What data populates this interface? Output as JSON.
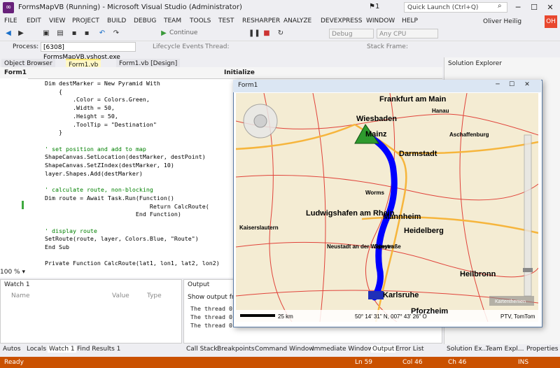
{
  "window": {
    "title": "FormsMapVB (Running) - Microsoft Visual Studio (Administrator)",
    "flag_count": "1",
    "quick_launch_placeholder": "Quick Launch (Ctrl+Q)",
    "user_name": "Oliver Heilig",
    "user_initials": "OH"
  },
  "menu": [
    "FILE",
    "EDIT",
    "VIEW",
    "PROJECT",
    "BUILD",
    "DEBUG",
    "TEAM",
    "TOOLS",
    "TEST",
    "RESHARPER",
    "ANALYZE",
    "DEVEXPRESS",
    "WINDOW",
    "HELP"
  ],
  "toolbar": {
    "continue_label": "Continue",
    "config": "Debug",
    "platform": "Any CPU"
  },
  "processbar": {
    "process_label": "Process:",
    "process_value": "[6308] FormsMapVB.vshost.exe",
    "lifecycle": "Lifecycle Events",
    "thread_label": "Thread:",
    "stack_label": "Stack Frame:"
  },
  "doc_tabs": {
    "object_browser": "Object Browser",
    "form1_vb": "Form1.vb",
    "form1_design": "Form1.vb [Design]",
    "nav_left": "Form1",
    "nav_right": "Initialize"
  },
  "code_lines": [
    {
      "t": "Dim destMarker = New Pyramid With"
    },
    {
      "t": "    {"
    },
    {
      "t": "        .Color = Colors.Green,"
    },
    {
      "t": "        .Width = 50,"
    },
    {
      "t": "        .Height = 50,"
    },
    {
      "t": "        .ToolTip = \"Destination\""
    },
    {
      "t": "    }"
    },
    {
      "t": ""
    },
    {
      "t": "' set position and add to map"
    },
    {
      "t": "ShapeCanvas.SetLocation(destMarker, destPoint)"
    },
    {
      "t": "ShapeCanvas.SetZIndex(destMarker, 10)"
    },
    {
      "t": "layer.Shapes.Add(destMarker)"
    },
    {
      "t": ""
    },
    {
      "t": "' calculate route, non-blocking"
    },
    {
      "t": "Dim route = Await Task.Run(Function()"
    },
    {
      "t": "                              Return CalcRoute("
    },
    {
      "t": "                          End Function)"
    },
    {
      "t": ""
    },
    {
      "t": "' display route"
    },
    {
      "t": "SetRoute(route, layer, Colors.Blue, \"Route\")"
    },
    {
      "t": "End Sub"
    },
    {
      "t": ""
    },
    {
      "t": "Private Function CalcRoute(lat1, lon1, lat2, lon2)"
    }
  ],
  "zoom_level": "100 %",
  "watch": {
    "title": "Watch 1",
    "col_name": "Name",
    "col_value": "Value",
    "col_type": "Type"
  },
  "output": {
    "title": "Output",
    "show_from": "Show output fro",
    "lines": [
      "The thread 0",
      "The thread 0",
      "The thread 0"
    ]
  },
  "form1": {
    "title": "Form1",
    "scale": "25 km",
    "coords": "50° 14' 31\" N, 007° 43' 26\" O",
    "copyright": "PTV, TomTom",
    "layer_btn": "Kartenthemen",
    "cities": [
      "Frankfurt am Main",
      "Hanau",
      "Wiesbaden",
      "Mainz",
      "Aschaffenburg",
      "Darmstadt",
      "Worms",
      "Ludwigshafen am Rhein",
      "Mannheim",
      "Kaiserslautern",
      "Heidelberg",
      "Neustadt an der Weinstraße",
      "Speyer",
      "Heilbronn",
      "Karlsruhe",
      "Pforzheim"
    ]
  },
  "bottom_tabs_left": [
    "Autos",
    "Locals",
    "Watch 1",
    "Find Results 1"
  ],
  "bottom_tabs_right": [
    "Call Stack",
    "Breakpoints",
    "Command Window",
    "Immediate Window",
    "Output",
    "Error List"
  ],
  "solution_tabs": [
    "Solution Ex...",
    "Team Expl...",
    "Properties"
  ],
  "solution_title": "Solution Explorer",
  "status": {
    "ready": "Ready",
    "ln": "Ln 59",
    "col": "Col 46",
    "ch": "Ch 46",
    "ins": "INS"
  },
  "colors": {
    "status_bar": "#ca5100",
    "route": "#0000ff",
    "destination_marker": "#2e9a2e"
  }
}
